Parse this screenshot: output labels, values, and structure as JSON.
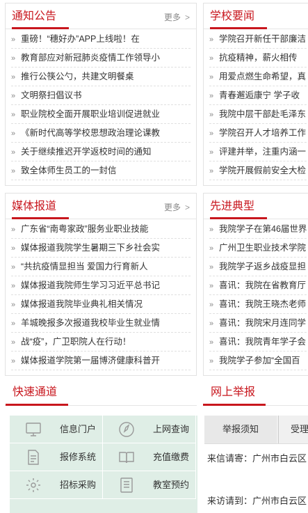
{
  "panels": {
    "notices": {
      "title": "通知公告",
      "more": "更多",
      "items": [
        "重磅！“穗好办”APP上线啦！在",
        "教育部应对新冠肺炎疫情工作领导小",
        "推行公筷公勺，共建文明餐桌",
        "文明祭扫倡议书",
        "职业院校全面开展职业培训促进就业",
        "《新时代高等学校思想政治理论课教",
        "关于继续推迟开学返校时间的通知",
        "致全体师生员工的一封信"
      ]
    },
    "school_news": {
      "title": "学校要闻",
      "items": [
        "学院召开新任干部廉洁",
        "抗疫精神，薪火相传",
        "用爱点燃生命希望，真",
        "青春邂逅康宁 学子收",
        "我院中层干部赴毛泽东",
        "学院召开人才培养工作",
        "评建并举，注重内涵一",
        "学院开展假前安全大检"
      ]
    },
    "media": {
      "title": "媒体报道",
      "more": "更多",
      "items": [
        "广东省“南粤家政”服务业职业技能",
        "媒体报道我院学生暑期三下乡社会实",
        "“共抗疫情显担当 爱国力行育新人",
        "媒体报道我院师生学习习近平总书记",
        "媒体报道我院毕业典礼相关情况",
        "羊城晚报多次报道我校毕业生就业情",
        "战“疫”，广卫职院人在行动！",
        "媒体报道学院第一届博济健康科普开"
      ]
    },
    "models": {
      "title": "先进典型",
      "items": [
        "我院学子在第46届世界",
        "广州卫生职业技术学院",
        "我院学子返乡战疫显担",
        "喜讯：我院在省教育厅",
        "喜讯：我院王晓杰老师",
        "喜讯：我院宋月连同学",
        "喜讯：我院青年学子会",
        "我院学子参加“全国百"
      ]
    }
  },
  "quick": {
    "title": "快速通道",
    "items": [
      {
        "label": "信息门户",
        "icon": "monitor-icon"
      },
      {
        "label": "上网查询",
        "icon": "compass-icon"
      },
      {
        "label": "报修系统",
        "icon": "document-icon"
      },
      {
        "label": "充值缴费",
        "icon": "book-icon"
      },
      {
        "label": "招标采购",
        "icon": "gear-icon"
      },
      {
        "label": "教室预约",
        "icon": "form-icon"
      }
    ]
  },
  "report": {
    "title": "网上举报",
    "tabs": [
      "举报须知",
      "受理"
    ],
    "lines": [
      "来信请寄：广州市白云区",
      "来访请到：广州市白云区"
    ]
  },
  "colors": {
    "accent": "#c8161d",
    "quick_bg": "#dfeee6"
  }
}
